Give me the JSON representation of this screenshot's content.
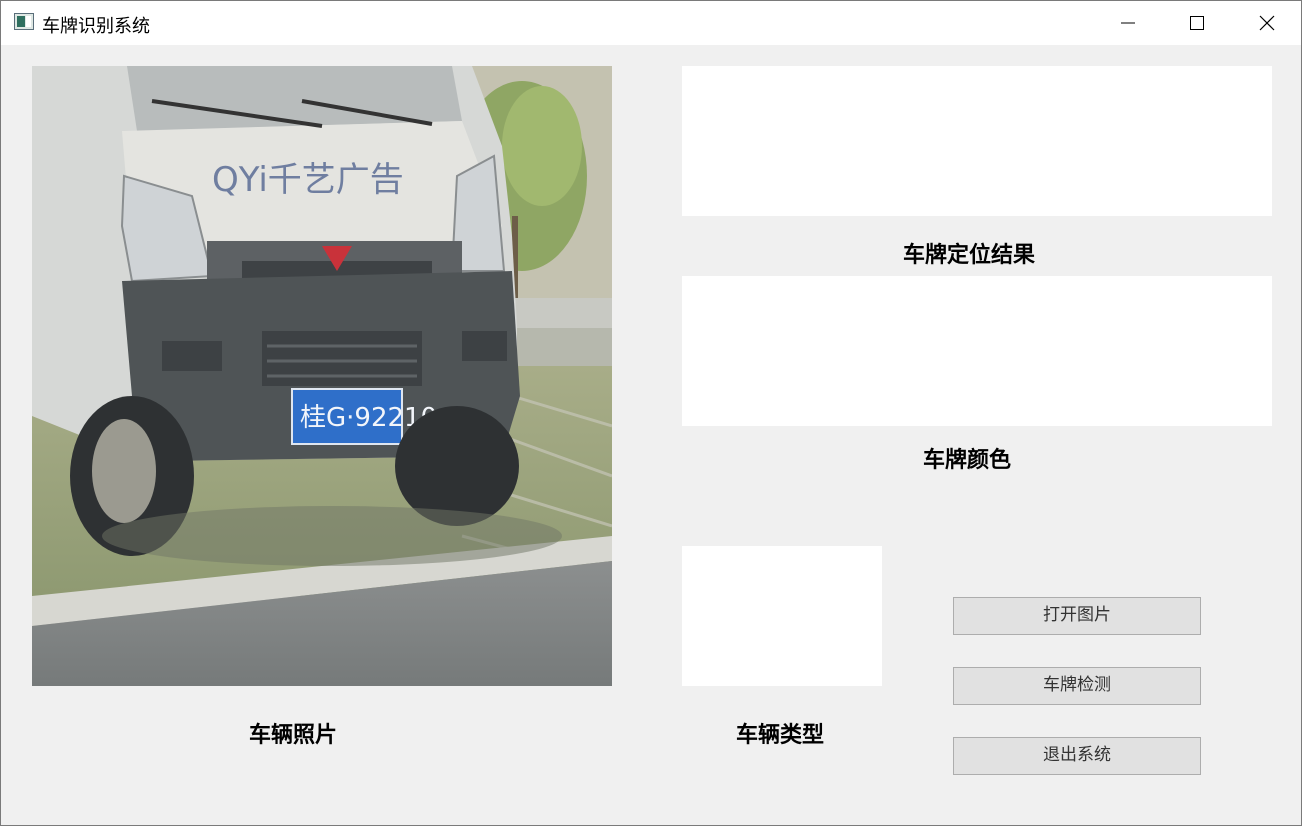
{
  "window": {
    "title": "车牌识别系统",
    "icon": "app-window-icon",
    "controls": [
      "minimize-icon",
      "maximize-icon",
      "close-icon"
    ]
  },
  "photo": {
    "label": "车辆照片",
    "hood_text": "QYi千艺广告",
    "plate_text": "桂G·92210",
    "plate_color": "#2f6fc9"
  },
  "results": {
    "location_label": "车牌定位结果",
    "color_label": "车牌颜色",
    "type_label": "车辆类型"
  },
  "buttons": {
    "open": "打开图片",
    "detect": "车牌检测",
    "exit": "退出系统"
  }
}
